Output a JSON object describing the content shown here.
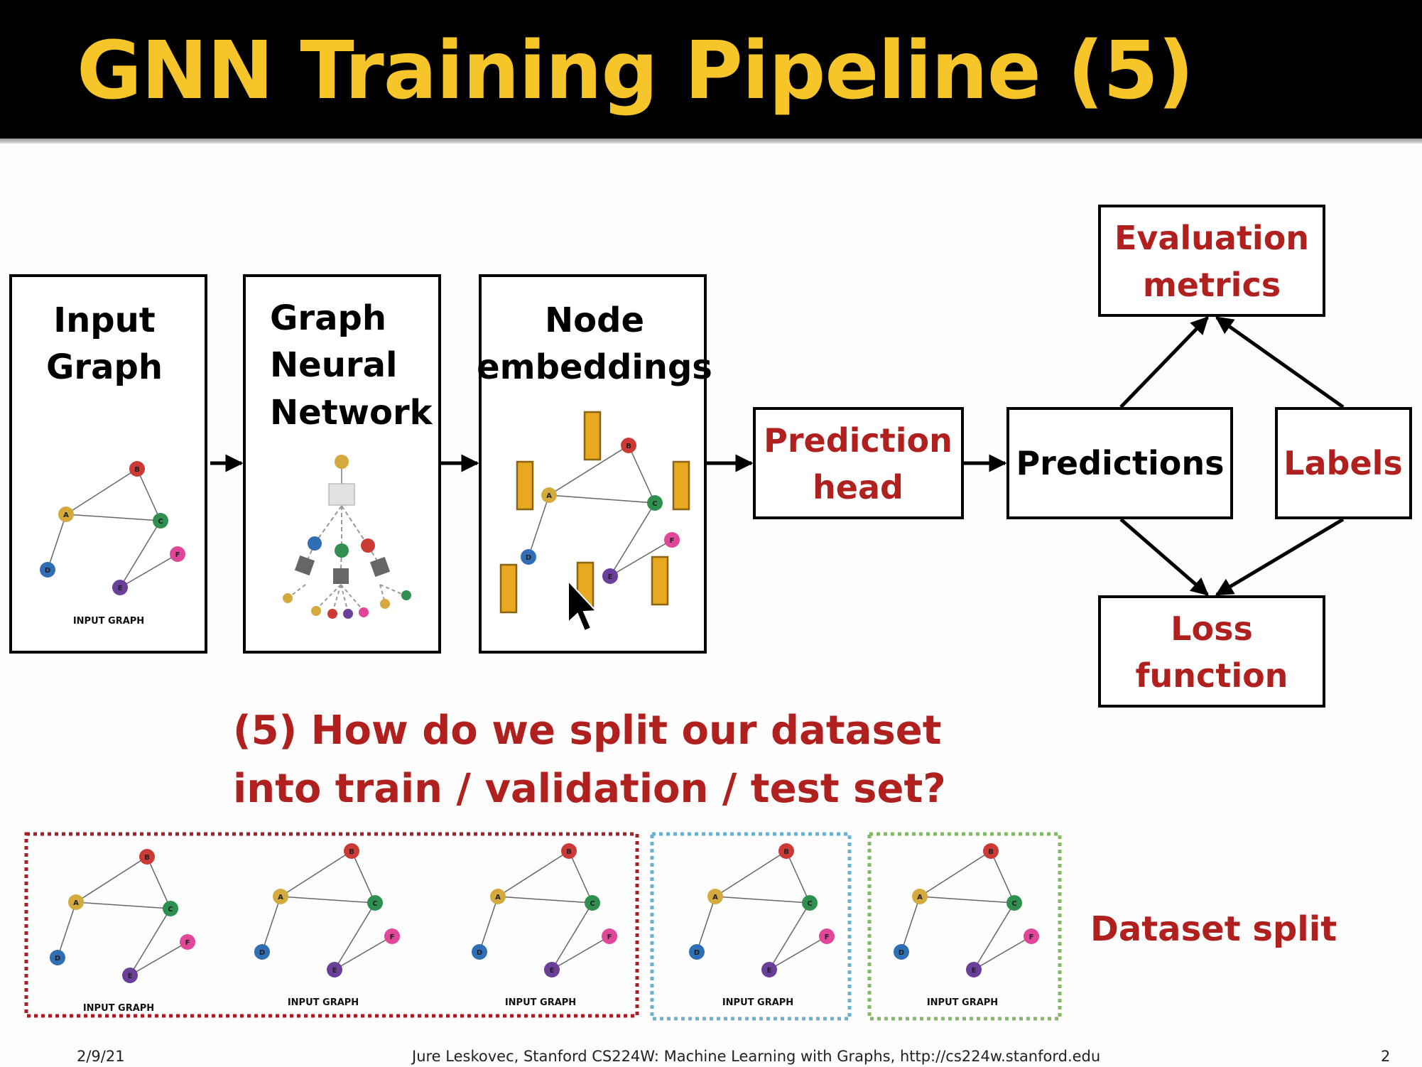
{
  "title": "GNN Training Pipeline (5)",
  "pipeline": {
    "input_graph": [
      "Input",
      "Graph"
    ],
    "gnn": [
      "Graph",
      "Neural",
      "Network"
    ],
    "node_embeddings": [
      "Node",
      "embeddings"
    ],
    "prediction_head": [
      "Prediction",
      "head"
    ],
    "predictions": "Predictions",
    "labels": "Labels",
    "evaluation_metrics": [
      "Evaluation",
      "metrics"
    ],
    "loss_function": [
      "Loss",
      "function"
    ]
  },
  "graph": {
    "caption": "INPUT GRAPH",
    "nodes": [
      "A",
      "B",
      "C",
      "D",
      "E",
      "F"
    ]
  },
  "question": {
    "line1": "(5) How do we split our dataset",
    "line2": "into train / validation / test set?"
  },
  "dataset_split_label": "Dataset split",
  "footer": {
    "date": "2/9/21",
    "credit": "Jure Leskovec, Stanford CS224W: Machine Learning with Graphs, http://cs224w.stanford.edu",
    "page": "2"
  },
  "colors": {
    "title": "#f5c52a",
    "accent_red": "#b0201e",
    "train_border": "#a81e22",
    "validation_border": "#6ab0d0",
    "test_border": "#82b866",
    "node_A": "#d4a93e",
    "node_B": "#cc3a35",
    "node_C": "#2f8f4e",
    "node_D": "#2f6db5",
    "node_E": "#6a3f9a",
    "node_F": "#e0479a",
    "embedding_bar": "#e8a820"
  }
}
